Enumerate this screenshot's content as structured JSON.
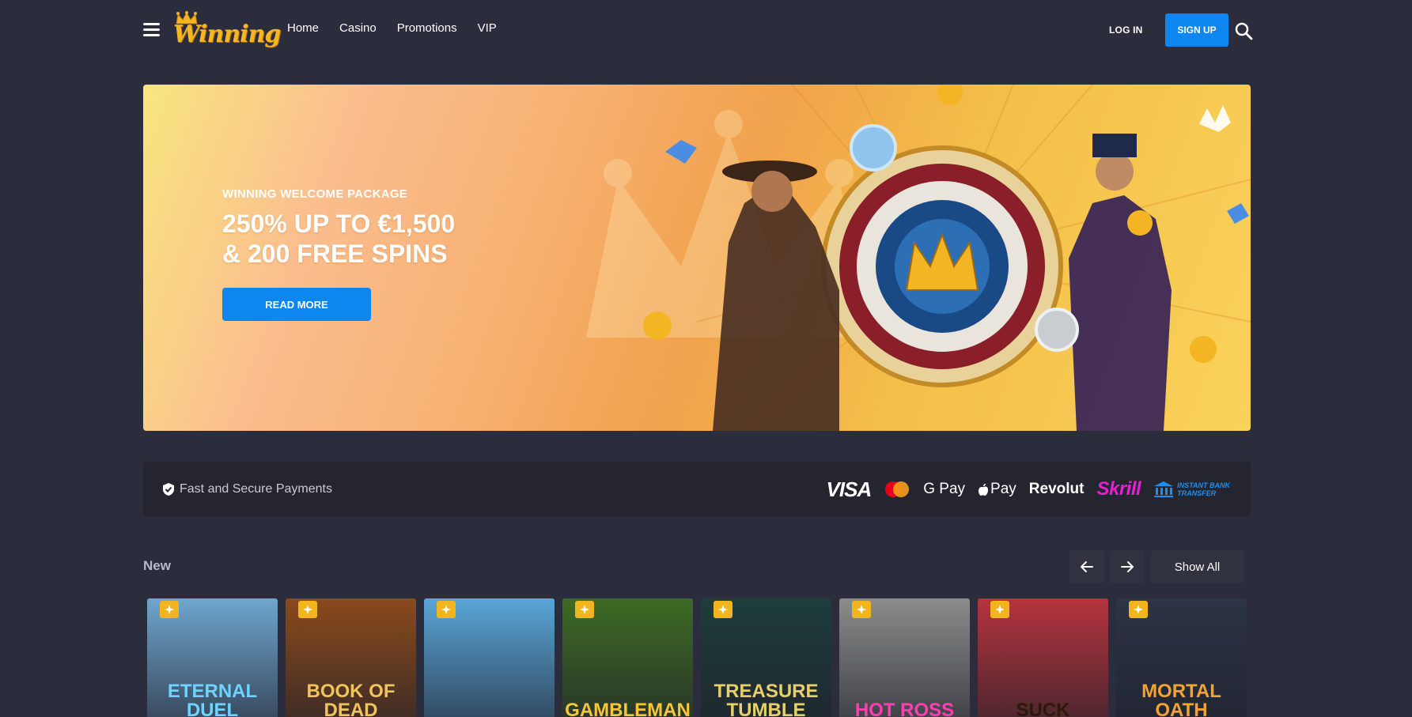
{
  "header": {
    "logo_text": "Winning",
    "nav": [
      "Home",
      "Casino",
      "Promotions",
      "VIP"
    ],
    "login_label": "LOG IN",
    "signup_label": "SIGN UP"
  },
  "banner": {
    "eyebrow": "WINNING WELCOME PACKAGE",
    "title_line1": "250% UP TO €1,500",
    "title_line2": "& 200 FREE SPINS",
    "cta_label": "READ MORE"
  },
  "payments": {
    "label": "Fast and Secure Payments",
    "logos": {
      "visa": "VISA",
      "gpay": "G Pay",
      "applepay": "Pay",
      "revolut": "Revolut",
      "skrill": "Skrill",
      "instant_line1": "INSTANT BANK",
      "instant_line2": "TRANSFER"
    }
  },
  "new_section": {
    "title": "New",
    "show_all_label": "Show All",
    "games": [
      {
        "name": "ETERNAL DUEL",
        "color": "#6fa6cf"
      },
      {
        "name": "BOOK OF DEAD",
        "color": "#8a4a1c"
      },
      {
        "name": "",
        "color": "#5aa6d8"
      },
      {
        "name": "GAMBLEMAN",
        "color": "#3d6b24"
      },
      {
        "name": "TREASURE TUMBLE",
        "color": "#1e3d3c"
      },
      {
        "name": "HOT ROSS",
        "color": "#8c8c8c"
      },
      {
        "name": "SUCK",
        "color": "#b5343c"
      },
      {
        "name": "MORTAL OATH",
        "color": "#2c3446"
      }
    ]
  },
  "colors": {
    "background": "#2b2d3c",
    "accent_blue": "#0d86f0",
    "logo_gold": "#f5b626"
  }
}
